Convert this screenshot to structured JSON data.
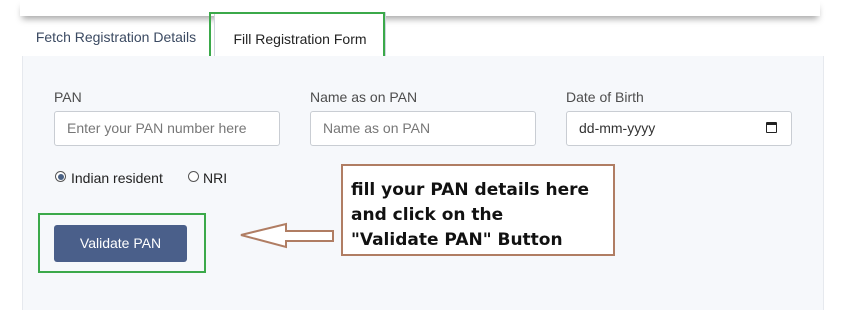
{
  "tabs": [
    {
      "label": "Fetch Registration Details",
      "active": false
    },
    {
      "label": "Fill Registration Form",
      "active": true
    }
  ],
  "form": {
    "pan": {
      "label": "PAN",
      "placeholder": "Enter your PAN number here"
    },
    "name": {
      "label": "Name as on PAN",
      "placeholder": "Name as on PAN"
    },
    "dob": {
      "label": "Date of Birth",
      "placeholder": "dd-mm-yyyy",
      "icon": "calendar-icon"
    },
    "residency": {
      "options": [
        "Indian resident",
        "NRI"
      ],
      "selected": "Indian resident"
    },
    "validate_label": "Validate PAN"
  },
  "annotation": {
    "lines": [
      "fill your PAN details here",
      "and click on the",
      "\"Validate PAN\" Button"
    ]
  },
  "colors": {
    "accent": "#4a5f8a",
    "highlight": "#3ba94a",
    "callout_border": "#b07d63"
  }
}
